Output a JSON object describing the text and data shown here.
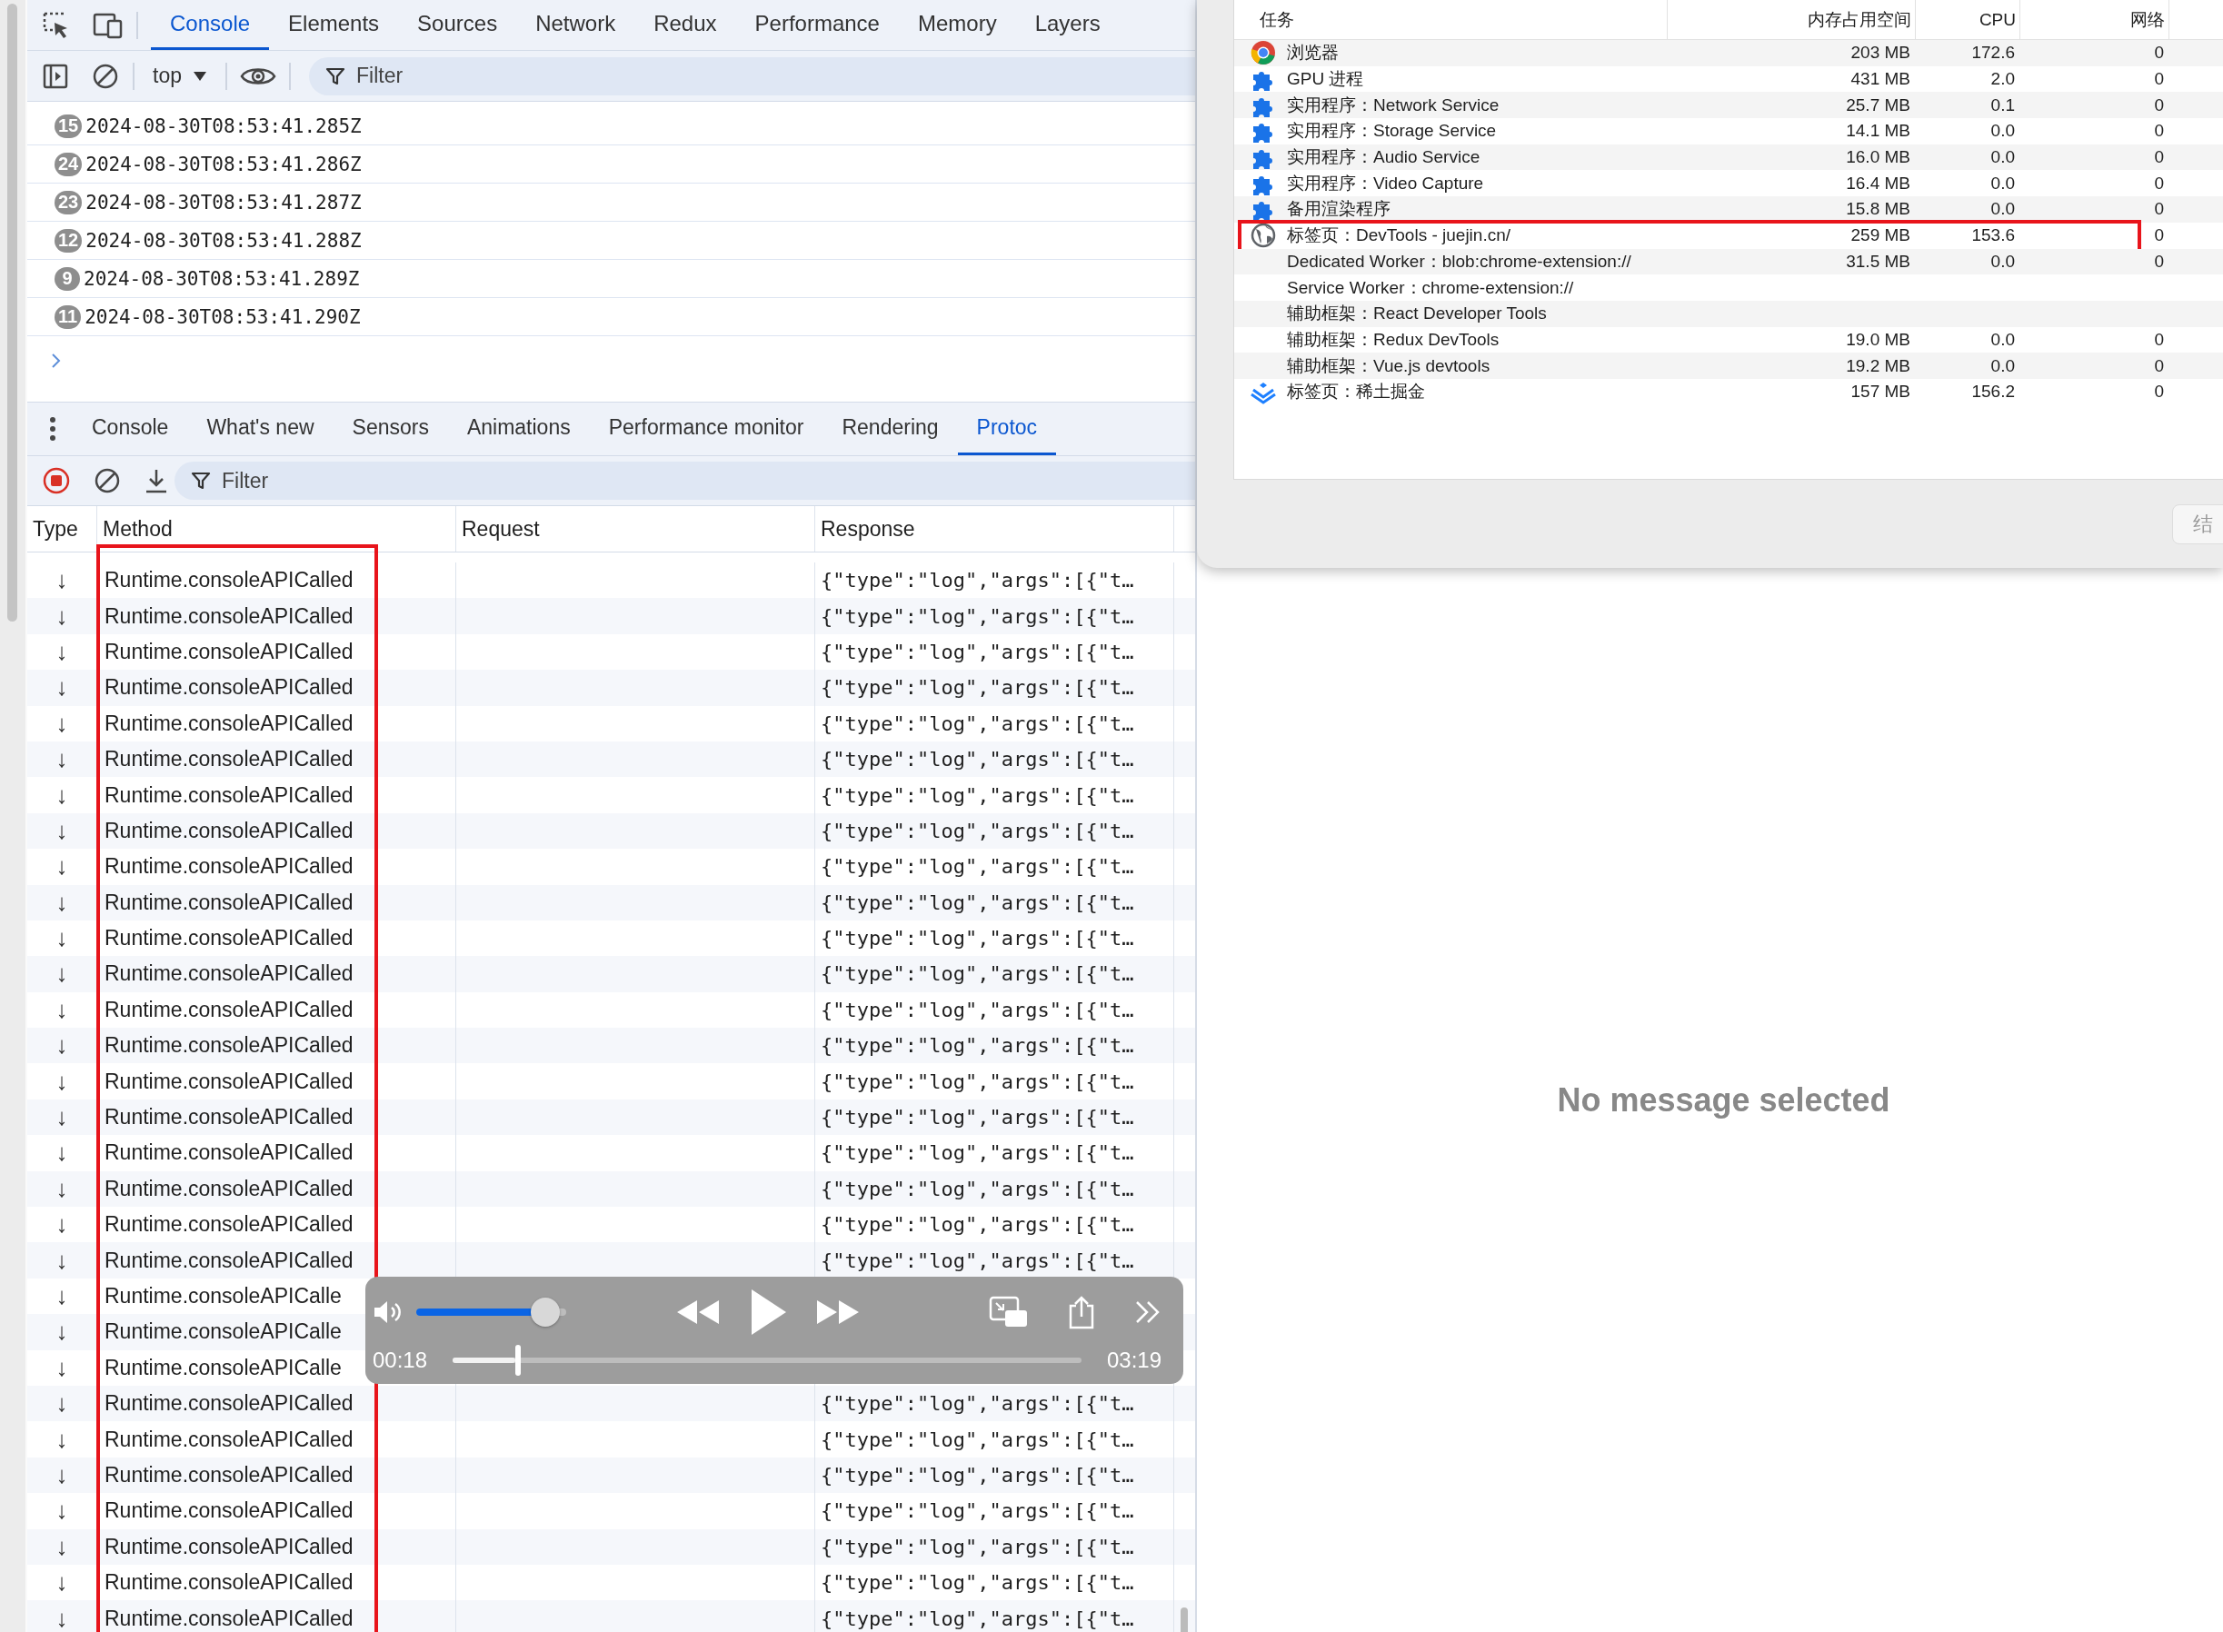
{
  "devtools": {
    "tabs": [
      {
        "label": "Console",
        "selected": true
      },
      {
        "label": "Elements",
        "selected": false
      },
      {
        "label": "Sources",
        "selected": false
      },
      {
        "label": "Network",
        "selected": false
      },
      {
        "label": "Redux",
        "selected": false
      },
      {
        "label": "Performance",
        "selected": false
      },
      {
        "label": "Memory",
        "selected": false
      },
      {
        "label": "Layers",
        "selected": false
      }
    ],
    "console_toolbar": {
      "context": "top",
      "filter_placeholder": "Filter"
    },
    "messages": [
      {
        "count": "15",
        "text": "2024-08-30T08:53:41.285Z"
      },
      {
        "count": "24",
        "text": "2024-08-30T08:53:41.286Z"
      },
      {
        "count": "23",
        "text": "2024-08-30T08:53:41.287Z"
      },
      {
        "count": "12",
        "text": "2024-08-30T08:53:41.288Z"
      },
      {
        "count": "9",
        "text": "2024-08-30T08:53:41.289Z"
      },
      {
        "count": "11",
        "text": "2024-08-30T08:53:41.290Z"
      }
    ]
  },
  "drawer": {
    "tabs": [
      {
        "label": "Console",
        "selected": false
      },
      {
        "label": "What's new",
        "selected": false
      },
      {
        "label": "Sensors",
        "selected": false
      },
      {
        "label": "Animations",
        "selected": false
      },
      {
        "label": "Performance monitor",
        "selected": false
      },
      {
        "label": "Rendering",
        "selected": false
      },
      {
        "label": "Protoc",
        "selected": true
      }
    ],
    "recording": true,
    "filter_placeholder": "Filter",
    "table": {
      "columns": [
        {
          "label": "Type",
          "highlighted": false
        },
        {
          "label": "Method",
          "highlighted": true
        },
        {
          "label": "Request",
          "highlighted": false
        },
        {
          "label": "Response",
          "highlighted": false
        }
      ],
      "rows": [
        {
          "type": "↓",
          "method": "Runtime.consoleAPICalled",
          "response": "{\"type\":\"log\",\"args\":[{\"t…"
        },
        {
          "type": "↓",
          "method": "Runtime.consoleAPICalled",
          "response": "{\"type\":\"log\",\"args\":[{\"t…"
        },
        {
          "type": "↓",
          "method": "Runtime.consoleAPICalled",
          "response": "{\"type\":\"log\",\"args\":[{\"t…"
        },
        {
          "type": "↓",
          "method": "Runtime.consoleAPICalled",
          "response": "{\"type\":\"log\",\"args\":[{\"t…"
        },
        {
          "type": "↓",
          "method": "Runtime.consoleAPICalled",
          "response": "{\"type\":\"log\",\"args\":[{\"t…"
        },
        {
          "type": "↓",
          "method": "Runtime.consoleAPICalled",
          "response": "{\"type\":\"log\",\"args\":[{\"t…"
        },
        {
          "type": "↓",
          "method": "Runtime.consoleAPICalled",
          "response": "{\"type\":\"log\",\"args\":[{\"t…"
        },
        {
          "type": "↓",
          "method": "Runtime.consoleAPICalled",
          "response": "{\"type\":\"log\",\"args\":[{\"t…"
        },
        {
          "type": "↓",
          "method": "Runtime.consoleAPICalled",
          "response": "{\"type\":\"log\",\"args\":[{\"t…"
        },
        {
          "type": "↓",
          "method": "Runtime.consoleAPICalled",
          "response": "{\"type\":\"log\",\"args\":[{\"t…"
        },
        {
          "type": "↓",
          "method": "Runtime.consoleAPICalled",
          "response": "{\"type\":\"log\",\"args\":[{\"t…"
        },
        {
          "type": "↓",
          "method": "Runtime.consoleAPICalled",
          "response": "{\"type\":\"log\",\"args\":[{\"t…"
        },
        {
          "type": "↓",
          "method": "Runtime.consoleAPICalled",
          "response": "{\"type\":\"log\",\"args\":[{\"t…"
        },
        {
          "type": "↓",
          "method": "Runtime.consoleAPICalled",
          "response": "{\"type\":\"log\",\"args\":[{\"t…"
        },
        {
          "type": "↓",
          "method": "Runtime.consoleAPICalled",
          "response": "{\"type\":\"log\",\"args\":[{\"t…"
        },
        {
          "type": "↓",
          "method": "Runtime.consoleAPICalled",
          "response": "{\"type\":\"log\",\"args\":[{\"t…"
        },
        {
          "type": "↓",
          "method": "Runtime.consoleAPICalled",
          "response": "{\"type\":\"log\",\"args\":[{\"t…"
        },
        {
          "type": "↓",
          "method": "Runtime.consoleAPICalled",
          "response": "{\"type\":\"log\",\"args\":[{\"t…"
        },
        {
          "type": "↓",
          "method": "Runtime.consoleAPICalled",
          "response": "{\"type\":\"log\",\"args\":[{\"t…"
        },
        {
          "type": "↓",
          "method": "Runtime.consoleAPICalled",
          "response": "{\"type\":\"log\",\"args\":[{\"t…"
        },
        {
          "type": "↓",
          "method": "Runtime.consoleAPICalle"
        },
        {
          "type": "↓",
          "method": "Runtime.consoleAPICalle"
        },
        {
          "type": "↓",
          "method": "Runtime.consoleAPICalle"
        },
        {
          "type": "↓",
          "method": "Runtime.consoleAPICalled",
          "response": "{\"type\":\"log\",\"args\":[{\"t…"
        },
        {
          "type": "↓",
          "method": "Runtime.consoleAPICalled",
          "response": "{\"type\":\"log\",\"args\":[{\"t…"
        },
        {
          "type": "↓",
          "method": "Runtime.consoleAPICalled",
          "response": "{\"type\":\"log\",\"args\":[{\"t…"
        },
        {
          "type": "↓",
          "method": "Runtime.consoleAPICalled",
          "response": "{\"type\":\"log\",\"args\":[{\"t…"
        },
        {
          "type": "↓",
          "method": "Runtime.consoleAPICalled",
          "response": "{\"type\":\"log\",\"args\":[{\"t…"
        },
        {
          "type": "↓",
          "method": "Runtime.consoleAPICalled",
          "response": "{\"type\":\"log\",\"args\":[{\"t…"
        },
        {
          "type": "↓",
          "method": "Runtime.consoleAPICalled",
          "response": "{\"type\":\"log\",\"args\":[{\"t…"
        }
      ]
    },
    "detail": {
      "message": "No message selected"
    }
  },
  "media_player": {
    "playing": false,
    "volume": {
      "level": 0.95
    },
    "elapsed": "00:18",
    "progress": {
      "level": 0.1
    },
    "duration": "03:19"
  },
  "task_manager": {
    "columns": [
      "任务",
      "内存占用空间",
      "CPU",
      "网络"
    ],
    "rows": [
      {
        "kind": "browser",
        "task": "浏览器",
        "memory": "203 MB",
        "cpu": "172.6",
        "network": "0",
        "highlighted": false
      },
      {
        "kind": "extension",
        "task": "GPU 进程",
        "memory": "431 MB",
        "cpu": "2.0",
        "network": "0",
        "highlighted": false
      },
      {
        "kind": "extension",
        "task": "实用程序：Network Service",
        "memory": "25.7 MB",
        "cpu": "0.1",
        "network": "0",
        "highlighted": false
      },
      {
        "kind": "extension",
        "task": "实用程序：Storage Service",
        "memory": "14.1 MB",
        "cpu": "0.0",
        "network": "0",
        "highlighted": false
      },
      {
        "kind": "extension",
        "task": "实用程序：Audio Service",
        "memory": "16.0 MB",
        "cpu": "0.0",
        "network": "0",
        "highlighted": false
      },
      {
        "kind": "extension",
        "task": "实用程序：Video Capture",
        "memory": "16.4 MB",
        "cpu": "0.0",
        "network": "0",
        "highlighted": false
      },
      {
        "kind": "extension",
        "task": "备用渲染程序",
        "memory": "15.8 MB",
        "cpu": "0.0",
        "network": "0",
        "highlighted": false
      },
      {
        "kind": "tab",
        "task": "标签页：DevTools - juejin.cn/",
        "memory": "259 MB",
        "cpu": "153.6",
        "network": "0",
        "highlighted": true,
        "children": [
          {
            "task": "Dedicated Worker：blob:chrome-extension://",
            "memory": "31.5 MB",
            "cpu": "0.0",
            "network": "0",
            "highlighted": false
          },
          {
            "task": "Service Worker：chrome-extension://",
            "highlighted": false
          },
          {
            "task": "辅助框架：React Developer Tools",
            "highlighted": false
          },
          {
            "task": "辅助框架：Redux DevTools",
            "memory": "19.0 MB",
            "cpu": "0.0",
            "network": "0",
            "highlighted": false
          },
          {
            "task": "辅助框架：Vue.js devtools",
            "memory": "19.2 MB",
            "cpu": "0.0",
            "network": "0",
            "highlighted": false
          }
        ]
      },
      {
        "kind": "site",
        "task": "标签页：稀土掘金",
        "memory": "157 MB",
        "cpu": "156.2",
        "network": "0",
        "highlighted": false
      }
    ],
    "end_button": "结"
  }
}
